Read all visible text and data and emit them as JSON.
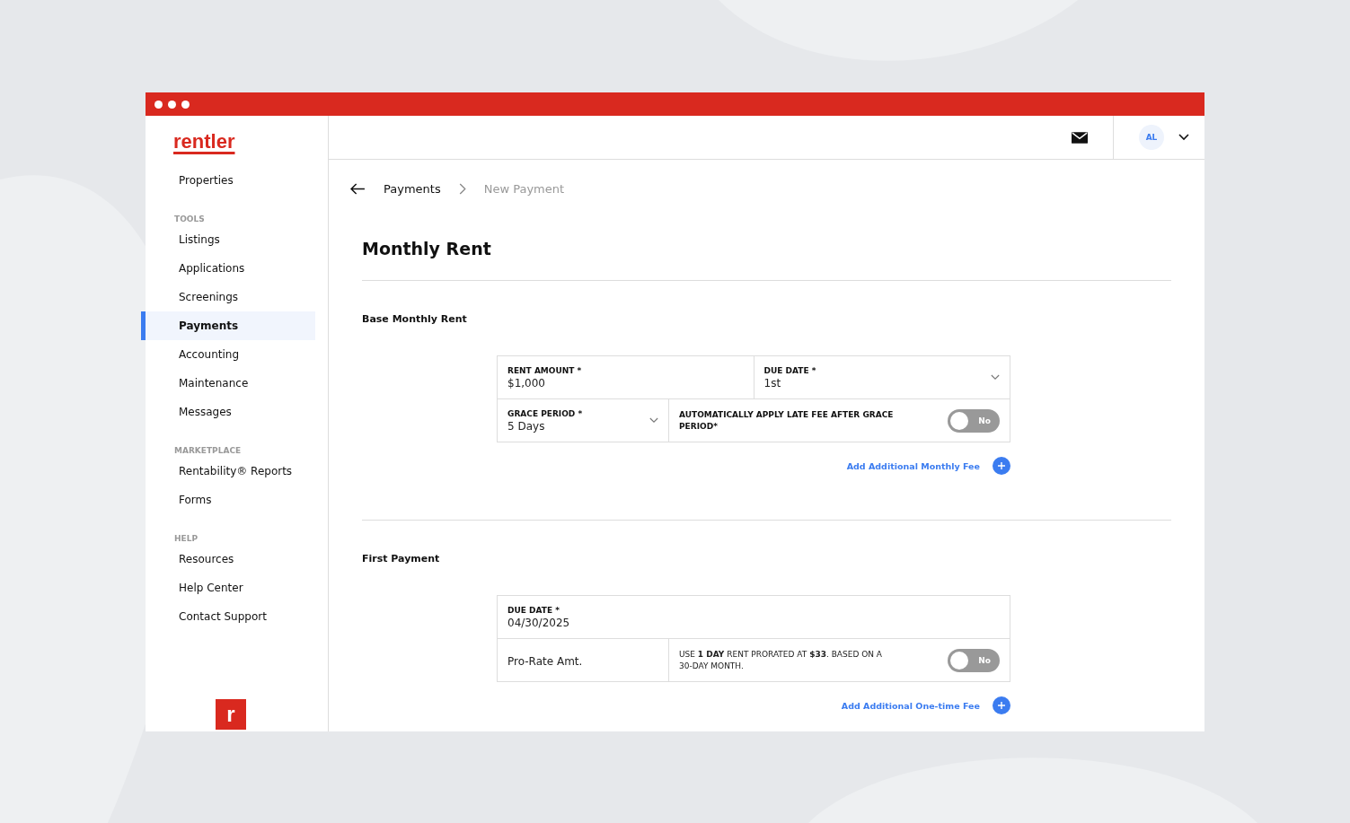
{
  "brand": {
    "logo": "rentler",
    "badge": "r"
  },
  "sidebar": {
    "groups": [
      {
        "items": [
          {
            "label": "Properties",
            "selected": false
          }
        ]
      },
      {
        "heading": "TOOLS",
        "items": [
          {
            "label": "Listings",
            "selected": false
          },
          {
            "label": "Applications",
            "selected": false
          },
          {
            "label": "Screenings",
            "selected": false
          },
          {
            "label": "Payments",
            "selected": true
          },
          {
            "label": "Accounting",
            "selected": false
          },
          {
            "label": "Maintenance",
            "selected": false
          },
          {
            "label": "Messages",
            "selected": false
          }
        ]
      },
      {
        "heading": "MARKETPLACE",
        "items": [
          {
            "label": "Rentability® Reports",
            "selected": false
          },
          {
            "label": "Forms",
            "selected": false
          }
        ]
      },
      {
        "heading": "HELP",
        "items": [
          {
            "label": "Resources",
            "selected": false
          },
          {
            "label": "Help Center",
            "selected": false
          },
          {
            "label": "Contact Support",
            "selected": false
          }
        ]
      }
    ]
  },
  "topbar": {
    "avatar": "AL"
  },
  "breadcrumb": {
    "parent": "Payments",
    "current": "New Payment"
  },
  "title": "Monthly Rent",
  "sections": [
    {
      "heading": "Base Monthly Rent",
      "rows": [
        [
          {
            "kind": "input",
            "label": "RENT AMOUNT *",
            "value": "$1,000"
          },
          {
            "kind": "select",
            "label": "DUE DATE *",
            "value": "1st"
          }
        ],
        [
          {
            "kind": "select",
            "label": "GRACE PERIOD *",
            "value": "5 Days"
          },
          {
            "kind": "toggle",
            "label": "AUTOMATICALLY APPLY LATE FEE AFTER GRACE PERIOD*",
            "on": false,
            "state_label": "No"
          }
        ]
      ],
      "add_link": "Add Additional Monthly Fee"
    },
    {
      "heading": "First Payment",
      "rows": [
        [
          {
            "kind": "input",
            "label": "DUE DATE *",
            "value": "04/30/2025"
          }
        ],
        [
          {
            "kind": "static",
            "value": "Pro-Rate Amt."
          },
          {
            "kind": "toggle",
            "note": "USE **1 DAY** RENT PRORATED AT **$33**. BASED ON A 30-DAY MONTH.",
            "on": false,
            "state_label": "No"
          }
        ]
      ],
      "add_link": "Add Additional One-time Fee"
    }
  ]
}
